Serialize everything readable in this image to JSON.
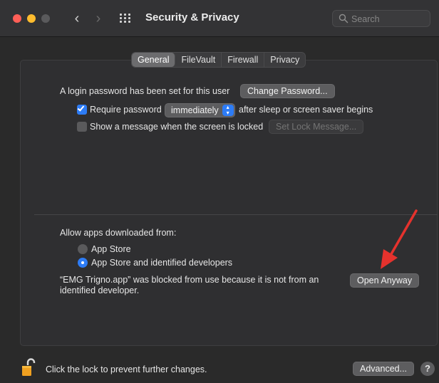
{
  "window": {
    "title": "Security & Privacy",
    "nav": {
      "back": "‹",
      "forward": "›"
    }
  },
  "search": {
    "placeholder": "Search",
    "value": ""
  },
  "tabs": [
    {
      "label": "General",
      "active": true
    },
    {
      "label": "FileVault",
      "active": false
    },
    {
      "label": "Firewall",
      "active": false
    },
    {
      "label": "Privacy",
      "active": false
    }
  ],
  "general": {
    "login_text": "A login password has been set for this user",
    "change_password_button": "Change Password...",
    "require_password": {
      "checked": true,
      "label": "Require password",
      "popup_value": "immediately",
      "suffix": "after sleep or screen saver begins"
    },
    "show_message": {
      "checked": false,
      "label": "Show a message when the screen is locked",
      "button": "Set Lock Message..."
    },
    "allow_apps": {
      "heading": "Allow apps downloaded from:",
      "options": [
        {
          "label": "App Store",
          "selected": false
        },
        {
          "label": "App Store and identified developers",
          "selected": true
        }
      ]
    },
    "blocked": {
      "line1": "“EMG Trigno.app” was blocked from use because it is not from an",
      "line2": "identified developer.",
      "open_anyway_button": "Open Anyway"
    }
  },
  "footer": {
    "lock_text": "Click the lock to prevent further changes.",
    "advanced_button": "Advanced...",
    "help_button": "?"
  },
  "colors": {
    "accent": "#2d7cf6",
    "annotation_arrow": "#e5322d"
  }
}
